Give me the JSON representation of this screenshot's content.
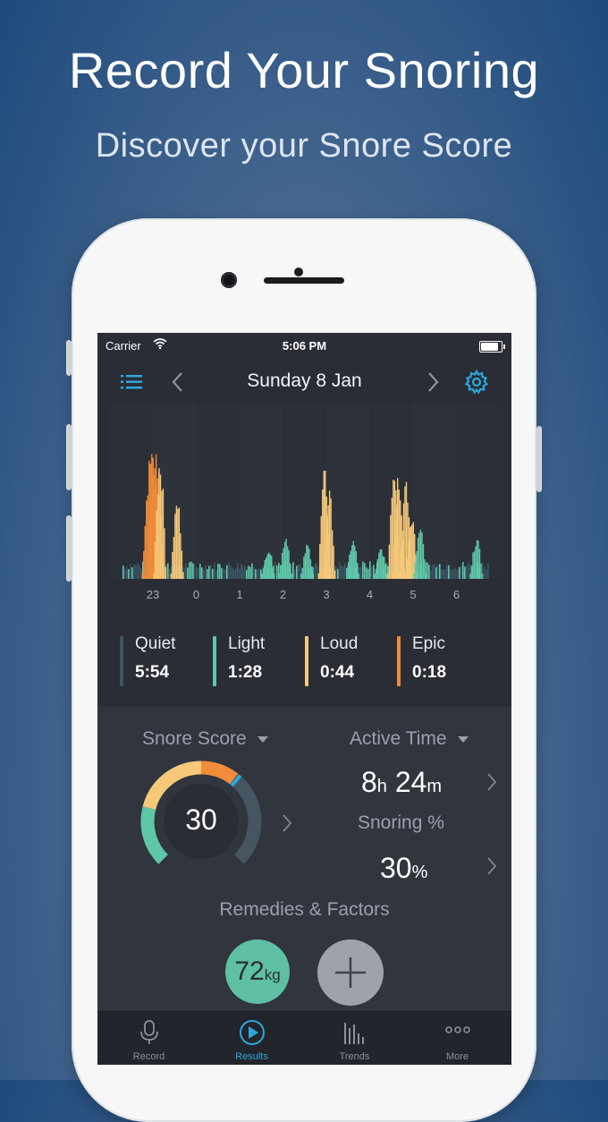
{
  "headline": "Record Your Snoring",
  "subline": "Discover your Snore Score",
  "status": {
    "carrier": "Carrier",
    "time": "5:06 PM"
  },
  "nav": {
    "date": "Sunday 8 Jan",
    "menu_icon": "list-icon",
    "prev_icon": "chevron-left-icon",
    "next_icon": "chevron-right-icon",
    "settings_icon": "gear-icon"
  },
  "chart_data": {
    "type": "area",
    "x_ticks": [
      "23",
      "0",
      "1",
      "2",
      "3",
      "4",
      "5",
      "6"
    ],
    "categories": [
      "Quiet",
      "Light",
      "Loud",
      "Epic"
    ],
    "colors": {
      "Quiet": "#3b5566",
      "Light": "#5fc7a8",
      "Loud": "#f6c97a",
      "Epic": "#f08c3a"
    },
    "events": [
      {
        "time": 22.95,
        "level": "Epic",
        "intensity": 0.82
      },
      {
        "time": 23.05,
        "level": "Epic",
        "intensity": 0.8
      },
      {
        "time": 23.15,
        "level": "Loud",
        "intensity": 0.78
      },
      {
        "time": 23.55,
        "level": "Loud",
        "intensity": 0.5
      },
      {
        "time": 1.65,
        "level": "Light",
        "intensity": 0.2
      },
      {
        "time": 2.05,
        "level": "Light",
        "intensity": 0.28
      },
      {
        "time": 2.55,
        "level": "Light",
        "intensity": 0.22
      },
      {
        "time": 2.95,
        "level": "Loud",
        "intensity": 0.68
      },
      {
        "time": 3.05,
        "level": "Loud",
        "intensity": 0.55
      },
      {
        "time": 3.6,
        "level": "Light",
        "intensity": 0.25
      },
      {
        "time": 4.25,
        "level": "Light",
        "intensity": 0.2
      },
      {
        "time": 4.55,
        "level": "Loud",
        "intensity": 0.73
      },
      {
        "time": 4.65,
        "level": "Loud",
        "intensity": 0.68
      },
      {
        "time": 4.82,
        "level": "Loud",
        "intensity": 0.6
      },
      {
        "time": 4.95,
        "level": "Loud",
        "intensity": 0.42
      },
      {
        "time": 5.15,
        "level": "Light",
        "intensity": 0.32
      },
      {
        "time": 6.45,
        "level": "Light",
        "intensity": 0.26
      }
    ]
  },
  "legend": [
    {
      "name": "Quiet",
      "value": "5:54",
      "color": "#3b5566"
    },
    {
      "name": "Light",
      "value": "1:28",
      "color": "#5fc7a8"
    },
    {
      "name": "Loud",
      "value": "0:44",
      "color": "#f6c97a"
    },
    {
      "name": "Epic",
      "value": "0:18",
      "color": "#f08c3a"
    }
  ],
  "score": {
    "label": "Snore Score",
    "value": "30",
    "fraction": 0.3
  },
  "active": {
    "label": "Active Time",
    "hours": "8",
    "h_unit": "h",
    "minutes": "24",
    "m_unit": "m"
  },
  "snoring": {
    "label": "Snoring %",
    "value": "30",
    "unit": "%"
  },
  "remedies": {
    "label": "Remedies & Factors",
    "weight": "72",
    "weight_unit": "kg"
  },
  "tabs": [
    {
      "label": "Record",
      "icon": "microphone-icon",
      "active": false
    },
    {
      "label": "Results",
      "icon": "play-circle-icon",
      "active": true
    },
    {
      "label": "Trends",
      "icon": "bar-chart-icon",
      "active": false
    },
    {
      "label": "More",
      "icon": "more-dots-icon",
      "active": false
    }
  ]
}
